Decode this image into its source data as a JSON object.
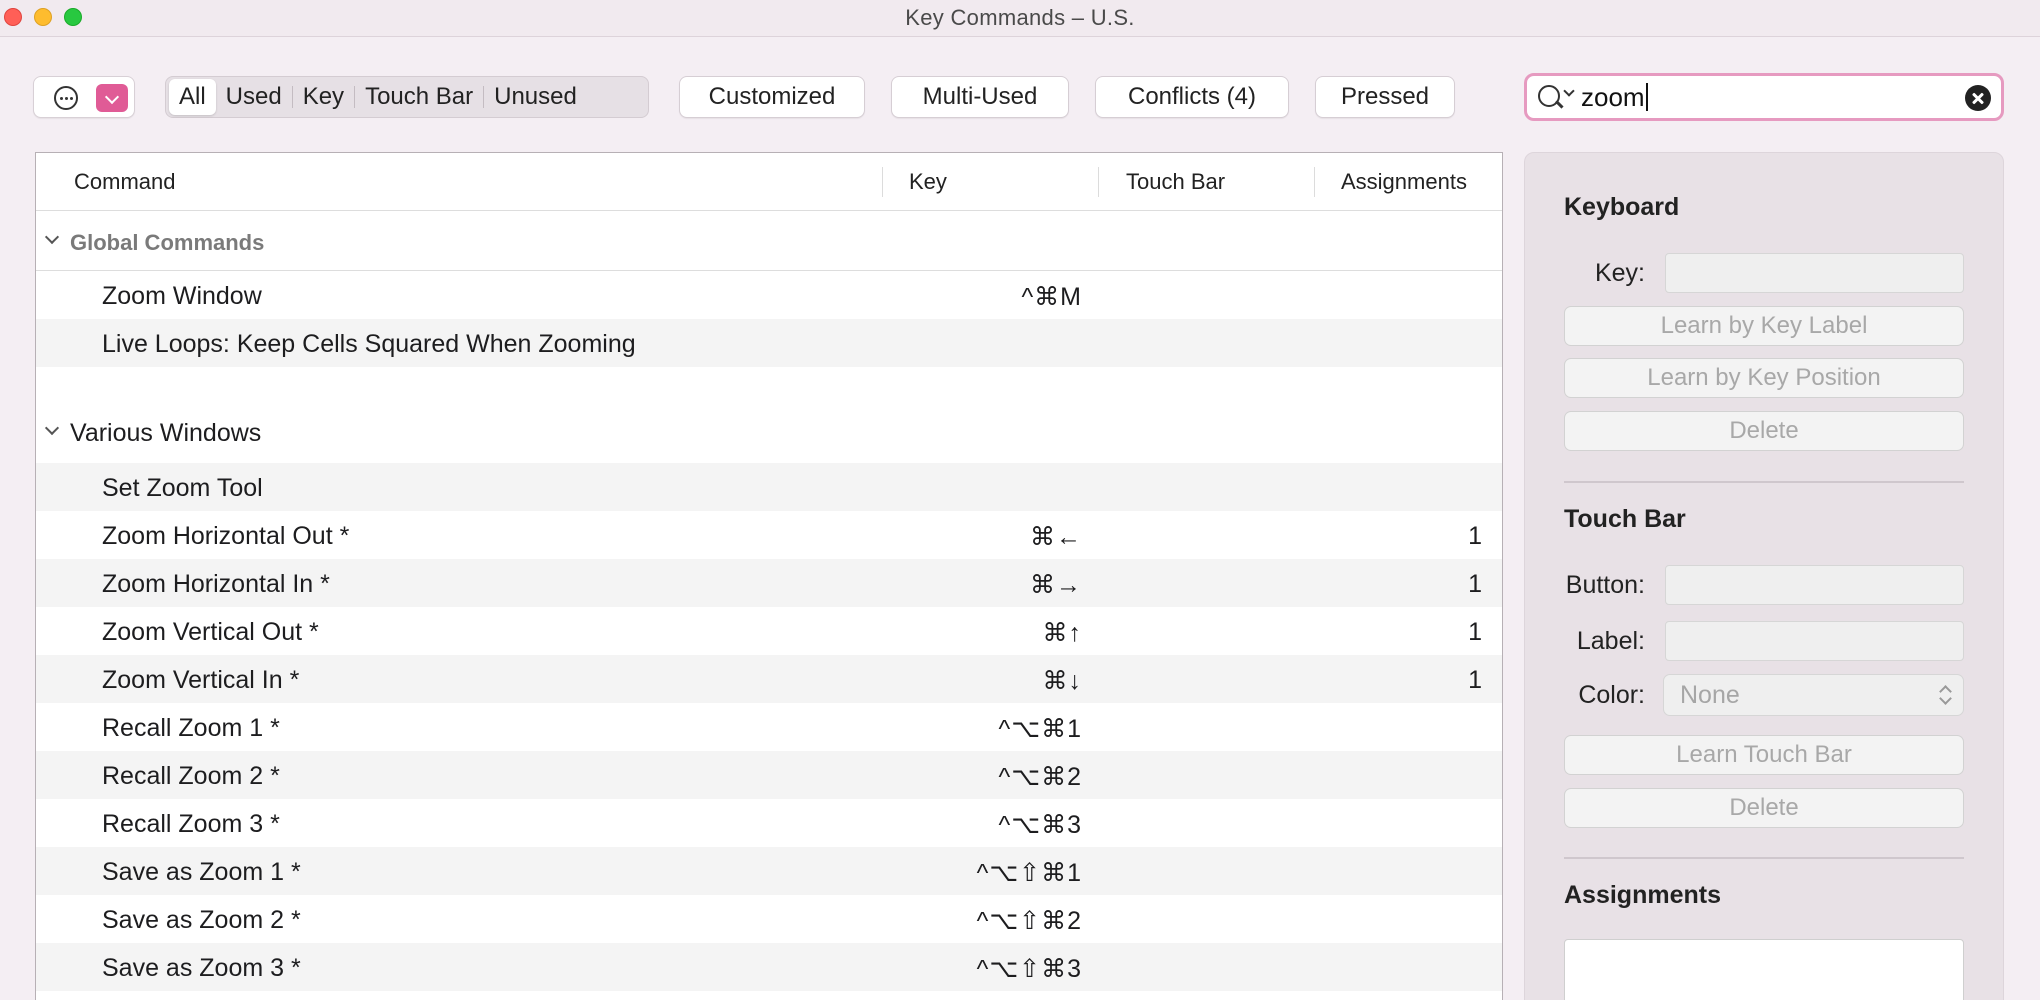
{
  "window": {
    "title": "Key Commands – U.S."
  },
  "toolbar": {
    "filters": [
      "All",
      "Used",
      "Key",
      "Touch Bar",
      "Unused"
    ],
    "active_filter": "All",
    "customized": "Customized",
    "multi_used": "Multi-Used",
    "conflicts": "Conflicts (4)",
    "pressed": "Pressed",
    "accent_color": "#e05b96"
  },
  "search": {
    "value": "zoom",
    "border_color": "#e69ac0"
  },
  "table": {
    "columns": {
      "command": "Command",
      "key": "Key",
      "touch_bar": "Touch Bar",
      "assignments": "Assignments"
    },
    "groups": [
      {
        "title": "Global Commands",
        "rows": [
          {
            "command": "Zoom Window",
            "key": "^⌘M",
            "assignments": ""
          },
          {
            "command": "Live Loops: Keep Cells Squared When Zooming",
            "key": "",
            "assignments": ""
          }
        ]
      },
      {
        "title": "Various Windows",
        "rows": [
          {
            "command": "Set Zoom Tool",
            "key": "",
            "assignments": ""
          },
          {
            "command": "Zoom Horizontal Out *",
            "key": "⌘←",
            "assignments": "1"
          },
          {
            "command": "Zoom Horizontal In *",
            "key": "⌘→",
            "assignments": "1"
          },
          {
            "command": "Zoom Vertical Out *",
            "key": "⌘↑",
            "assignments": "1"
          },
          {
            "command": "Zoom Vertical In *",
            "key": "⌘↓",
            "assignments": "1"
          },
          {
            "command": "Recall Zoom 1 *",
            "key": "^⌥⌘1",
            "assignments": ""
          },
          {
            "command": "Recall Zoom 2 *",
            "key": "^⌥⌘2",
            "assignments": ""
          },
          {
            "command": "Recall Zoom 3 *",
            "key": "^⌥⌘3",
            "assignments": ""
          },
          {
            "command": "Save as Zoom 1 *",
            "key": "^⌥⇧⌘1",
            "assignments": ""
          },
          {
            "command": "Save as Zoom 2 *",
            "key": "^⌥⇧⌘2",
            "assignments": ""
          },
          {
            "command": "Save as Zoom 3 *",
            "key": "^⌥⇧⌘3",
            "assignments": ""
          }
        ]
      }
    ]
  },
  "panel": {
    "keyboard": {
      "heading": "Keyboard",
      "key_label": "Key:",
      "learn_label": "Learn by Key Label",
      "learn_position": "Learn by Key Position",
      "delete": "Delete"
    },
    "touch_bar": {
      "heading": "Touch Bar",
      "button_label": "Button:",
      "label_label": "Label:",
      "color_label": "Color:",
      "color_value": "None",
      "learn": "Learn Touch Bar",
      "delete": "Delete"
    },
    "assignments": {
      "heading": "Assignments"
    }
  }
}
